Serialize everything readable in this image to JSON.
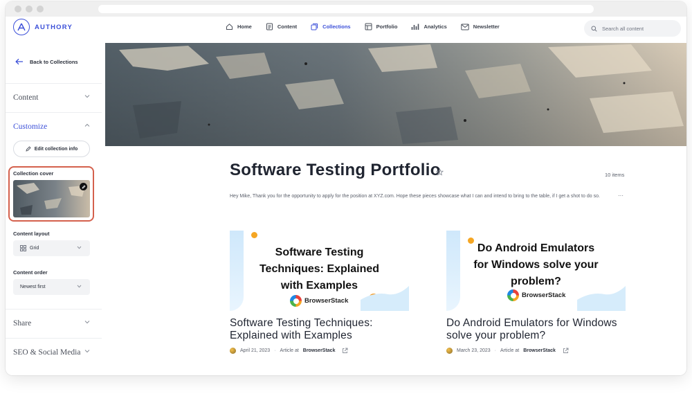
{
  "brand": {
    "name": "AUTHORY",
    "accent": "#3b4fd8",
    "highlight": "#d4604c"
  },
  "nav": {
    "items": [
      {
        "label": "Home",
        "icon": "home-icon"
      },
      {
        "label": "Content",
        "icon": "content-icon"
      },
      {
        "label": "Collections",
        "icon": "collections-icon",
        "active": true
      },
      {
        "label": "Portfolio",
        "icon": "portfolio-icon"
      },
      {
        "label": "Analytics",
        "icon": "analytics-icon"
      },
      {
        "label": "Newsletter",
        "icon": "newsletter-icon"
      }
    ],
    "search_placeholder": "Search all content"
  },
  "sidebar": {
    "back_label": "Back to Collections",
    "sections": [
      {
        "title": "Content",
        "expanded": false
      },
      {
        "title": "Customize",
        "expanded": true
      },
      {
        "title": "Share",
        "expanded": false
      },
      {
        "title": "SEO & Social Media",
        "expanded": false
      }
    ],
    "edit_button": "Edit collection info",
    "cover_label": "Collection cover",
    "layout_label": "Content layout",
    "layout_value": "Grid",
    "order_label": "Content order",
    "order_value": "Newest first"
  },
  "collection": {
    "title": "Software Testing Portfolio",
    "items_count": "10 items",
    "description": "Hey Mike, Thank you for the opportunity to apply for the position at XYZ.com. Hope these pieces showcase what I can and intend to bring to the table, if I get a shot to do so.",
    "more_label": "···"
  },
  "cards": [
    {
      "thumb_heading": "Software Testing Techniques: Explained with Examples",
      "thumb_brand": "BrowserStack",
      "title": "Software Testing Techniques: Explained with Examples",
      "date": "April 21, 2023",
      "type": "Article at",
      "source": "BrowserStack"
    },
    {
      "thumb_heading": "Do Android Emulators for Windows solve your problem?",
      "thumb_brand": "BrowserStack",
      "title": "Do Android Emulators for Windows solve your problem?",
      "date": "March 23, 2023",
      "type": "Article at",
      "source": "BrowserStack"
    }
  ]
}
